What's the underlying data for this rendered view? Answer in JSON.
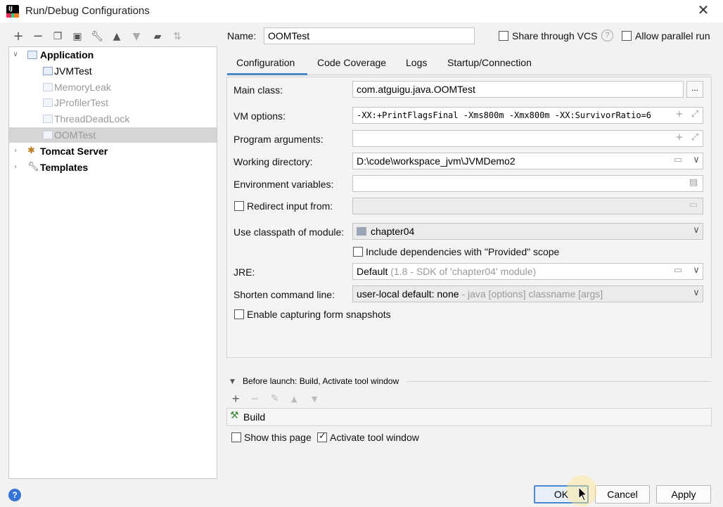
{
  "window": {
    "title": "Run/Debug Configurations",
    "logo_text": "IJ"
  },
  "toolbar": {
    "icons": [
      "add-icon",
      "remove-icon",
      "copy-icon",
      "save-icon",
      "wrench-icon",
      "move-up-icon",
      "move-down-icon",
      "folder-icon",
      "sort-icon"
    ]
  },
  "tree": {
    "application": "Application",
    "items": [
      "JVMTest",
      "MemoryLeak",
      "JProfilerTest",
      "ThreadDeadLock",
      "OOMTest"
    ],
    "tomcat": "Tomcat Server",
    "templates": "Templates"
  },
  "header": {
    "name_label": "Name:",
    "name_value": "OOMTest",
    "share_vcs": "Share through VCS",
    "allow_parallel": "Allow parallel run"
  },
  "tabs": [
    "Configuration",
    "Code Coverage",
    "Logs",
    "Startup/Connection"
  ],
  "form": {
    "main_class_label": "Main class:",
    "main_class_value": "com.atguigu.java.OOMTest",
    "browse_label": "...",
    "vm_options_label": "VM options:",
    "vm_options_value": "-XX:+PrintFlagsFinal -Xms800m -Xmx800m -XX:SurvivorRatio=6",
    "program_args_label": "Program arguments:",
    "program_args_value": "",
    "working_dir_label": "Working directory:",
    "working_dir_value": "D:\\code\\workspace_jvm\\JVMDemo2",
    "env_vars_label": "Environment variables:",
    "env_vars_value": "",
    "redirect_label": "Redirect input from:",
    "classpath_label": "Use classpath of module:",
    "classpath_value": "chapter04",
    "include_deps_label": "Include dependencies with \"Provided\" scope",
    "jre_label": "JRE:",
    "jre_value": "Default",
    "jre_hint": " (1.8 - SDK of 'chapter04' module)",
    "shorten_label": "Shorten command line:",
    "shorten_value": "user-local default: none",
    "shorten_hint": " - java [options] classname [args]",
    "snapshots_label": "Enable capturing form snapshots"
  },
  "before_launch": {
    "title": "Before launch: Build, Activate tool window",
    "item": "Build",
    "show_page": "Show this page",
    "activate_tool": "Activate tool window"
  },
  "buttons": {
    "help": "?",
    "ok": "OK",
    "cancel": "Cancel",
    "apply": "Apply"
  },
  "colors": {
    "accent": "#4a88c7",
    "selection": "#d5d5d5",
    "help": "#3574d6"
  }
}
